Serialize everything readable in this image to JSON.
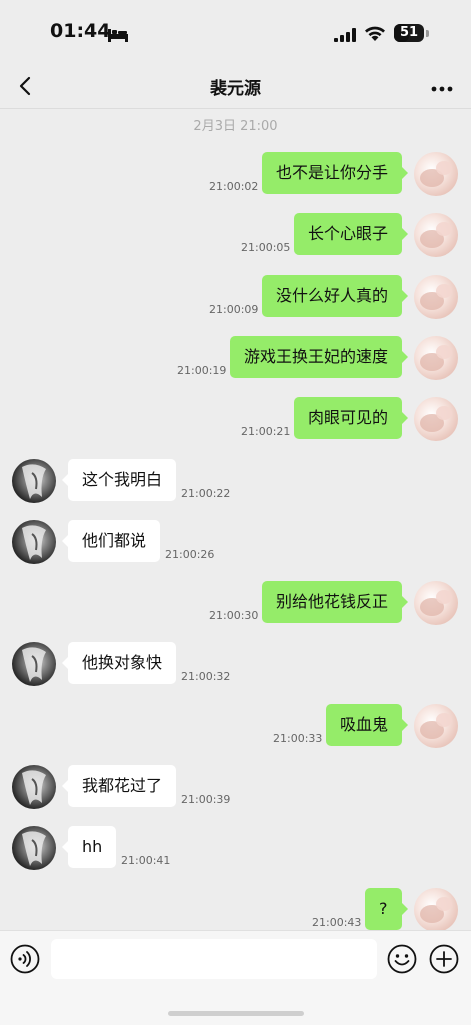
{
  "status_bar": {
    "time": "01:44",
    "battery": "51",
    "battery_level": 0.51
  },
  "header": {
    "title": "裴元源"
  },
  "date_divider": "2月3日 21:00",
  "messages": [
    {
      "sender": "me",
      "text": "也不是让你分手",
      "time": "21:00:02"
    },
    {
      "sender": "me",
      "text": "长个心眼子",
      "time": "21:00:05"
    },
    {
      "sender": "me",
      "text": "没什么好人真的",
      "time": "21:00:09"
    },
    {
      "sender": "me",
      "text": "游戏王换王妃的速度",
      "time": "21:00:19"
    },
    {
      "sender": "me",
      "text": "肉眼可见的",
      "time": "21:00:21"
    },
    {
      "sender": "other",
      "text": "这个我明白",
      "time": "21:00:22"
    },
    {
      "sender": "other",
      "text": "他们都说",
      "time": "21:00:26"
    },
    {
      "sender": "me",
      "text": "别给他花钱反正",
      "time": "21:00:30"
    },
    {
      "sender": "other",
      "text": "他换对象快",
      "time": "21:00:32"
    },
    {
      "sender": "me",
      "text": "吸血鬼",
      "time": "21:00:33"
    },
    {
      "sender": "other",
      "text": "我都花过了",
      "time": "21:00:39"
    },
    {
      "sender": "other",
      "text": "hh",
      "time": "21:00:41"
    },
    {
      "sender": "me",
      "text": "?",
      "time": "21:00:43"
    }
  ],
  "input_bar": {
    "value": "",
    "placeholder": ""
  },
  "icons": {
    "back": "chevron-left-icon",
    "more": "more-dots-icon",
    "voice": "voice-icon",
    "emoji": "emoji-icon",
    "plus": "plus-icon",
    "bed": "bed-icon",
    "signal": "signal-icon",
    "wifi": "wifi-icon"
  },
  "colors": {
    "my_bubble": "#95ec69",
    "their_bubble": "#ffffff",
    "background": "#ededed"
  }
}
